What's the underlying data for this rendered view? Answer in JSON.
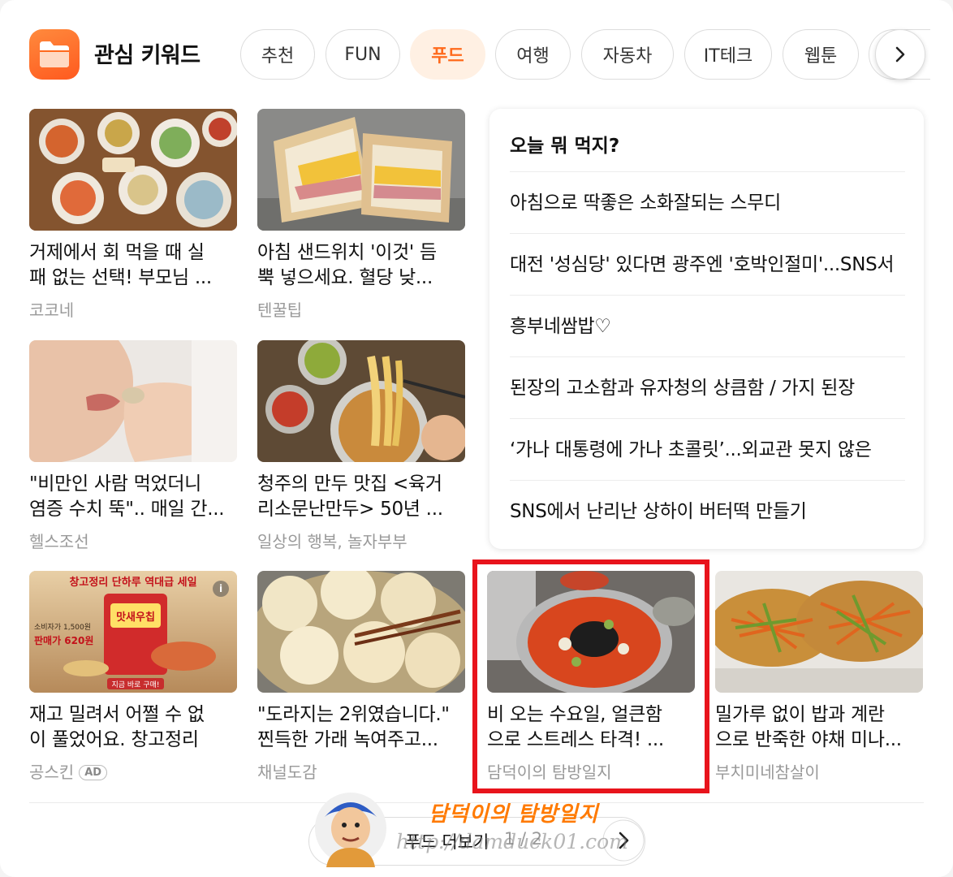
{
  "header": {
    "title": "관심 키워드",
    "tabs": [
      {
        "label": "추천",
        "active": false
      },
      {
        "label": "FUN",
        "active": false
      },
      {
        "label": "푸드",
        "active": true
      },
      {
        "label": "여행",
        "active": false
      },
      {
        "label": "자동차",
        "active": false
      },
      {
        "label": "IT테크",
        "active": false
      },
      {
        "label": "웹툰",
        "active": false
      },
      {
        "label": "",
        "active": false
      }
    ],
    "next_icon": "chevron-right-icon"
  },
  "articles": [
    {
      "title_lines": [
        "거제에서 회 먹을 때 실",
        "패 없는 선택! 부모님 ..."
      ],
      "source": "코코네",
      "ad": false
    },
    {
      "title_lines": [
        "아침 샌드위치 '이것' 듬",
        "뿍 넣으세요. 혈당 낮..."
      ],
      "source": "텐꿀팁",
      "ad": false
    },
    {
      "title_lines": [
        "\"비만인 사람 먹었더니",
        "염증 수치 뚝\".. 매일 간..."
      ],
      "source": "헬스조선",
      "ad": false
    },
    {
      "title_lines": [
        "청주의 만두 맛집 <육거",
        "리소문난만두> 50년 ..."
      ],
      "source": "일상의 행복, 놀자부부",
      "ad": false
    },
    {
      "title_lines": [
        "재고 밀려서 어쩔 수 없",
        "이 풀었어요. 창고정리"
      ],
      "source": "공스킨",
      "ad": true,
      "ad_label": "AD",
      "thumb_text": {
        "banner": "창고정리 단하루 역대급 세일",
        "brand": "맛새우칩",
        "price_label": "소비자가 1,500원",
        "sale_label": "판매가 620원",
        "cta": "지금 바로 구매!"
      }
    },
    {
      "title_lines": [
        "\"도라지는 2위였습니다.\"",
        "찐득한 가래 녹여주고..."
      ],
      "source": "채널도감",
      "ad": false
    },
    {
      "title_lines": [
        "비 오는 수요일, 얼큰함",
        "으로 스트레스 타격! ..."
      ],
      "source": "담덕이의 탐방일지",
      "ad": false
    },
    {
      "title_lines": [
        "밀가루 없이 밥과 계란",
        "으로 반죽한 야채 미나..."
      ],
      "source": "부치미네참살이",
      "ad": false
    }
  ],
  "panel": {
    "title": "오늘 뭐 먹지?",
    "items": [
      "아침으로 딱좋은 소화잘되는 스무디",
      "대전 '성심당' 있다면 광주엔 '호박인절미'...SNS서",
      "흥부네쌈밥♡",
      "된장의 고소함과 유자청의 상큼함 / 가지 된장",
      "‘가나 대통령에 가나 초콜릿’...외교관 못지 않은",
      "SNS에서 난리난 상하이 버터떡 만들기"
    ]
  },
  "more": {
    "label": "푸드 더보기",
    "count": "1 / 2",
    "icon": "chevron-right-icon"
  },
  "watermark": {
    "script": "담덕이의 탐방일지",
    "url": "http://damduck01.com"
  },
  "colors": {
    "accent": "#ff6a1c",
    "active_tab_bg": "#fff0e3",
    "highlight": "#e8141c",
    "source_text": "#999999"
  }
}
